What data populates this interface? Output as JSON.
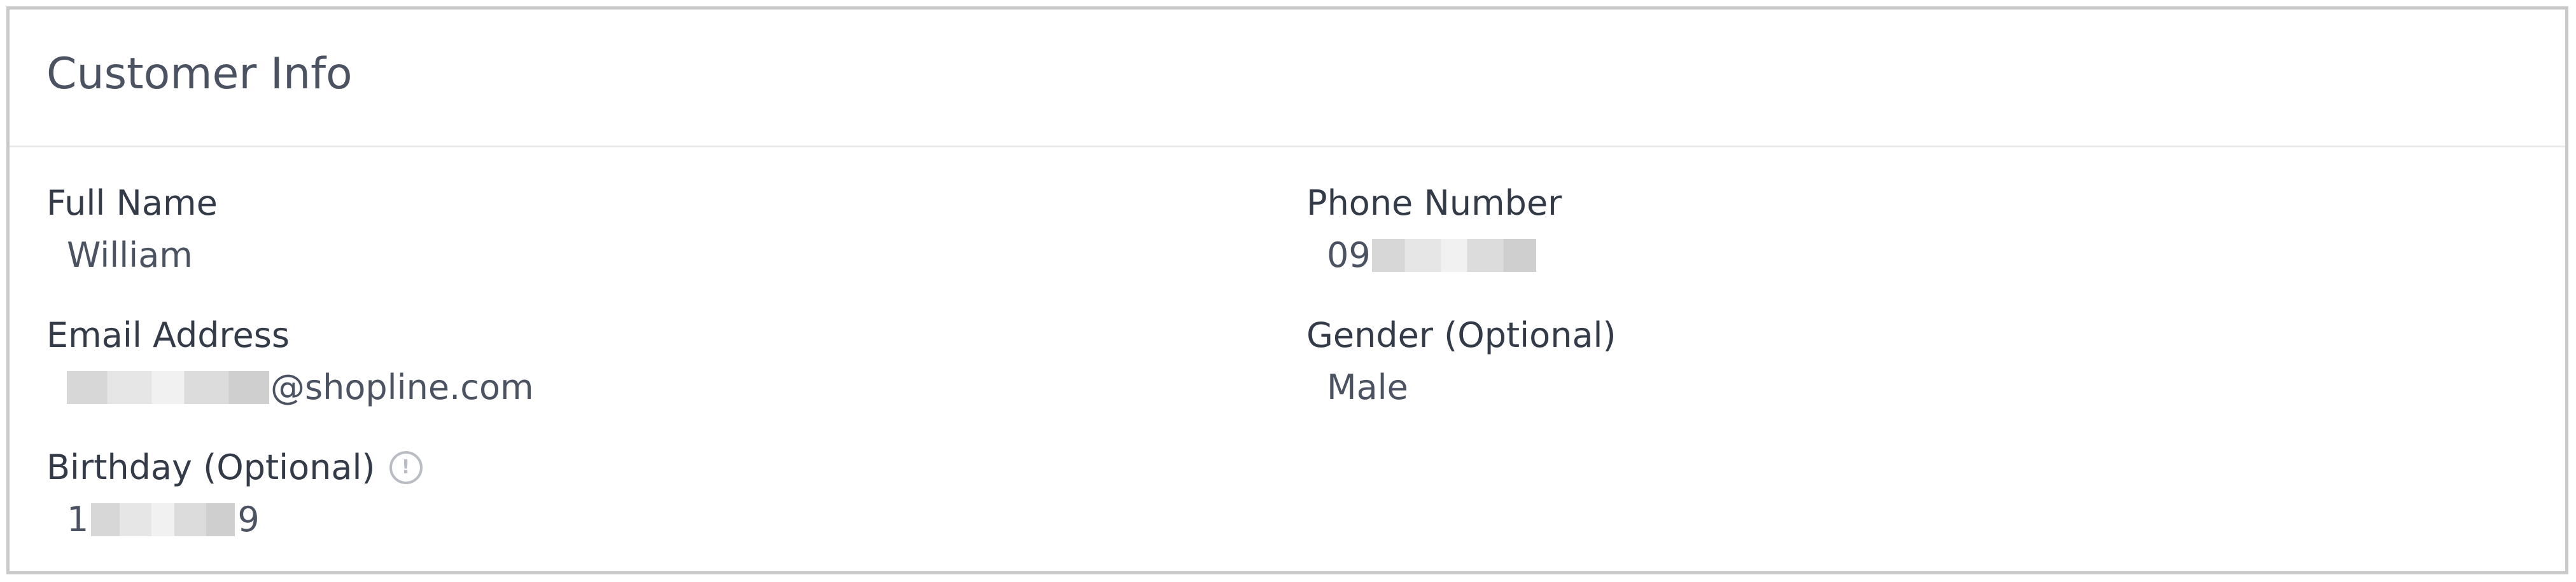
{
  "card": {
    "title": "Customer Info"
  },
  "fields": {
    "full_name": {
      "label": "Full Name",
      "value": "William"
    },
    "phone_number": {
      "label": "Phone Number",
      "value_prefix": "09"
    },
    "email_address": {
      "label": "Email Address",
      "value_suffix": "@shopline.com"
    },
    "gender": {
      "label": "Gender (Optional)",
      "value": "Male"
    },
    "birthday": {
      "label": "Birthday (Optional)",
      "info_icon": "info-circle-icon",
      "value_prefix": "1",
      "value_suffix": "9"
    }
  }
}
